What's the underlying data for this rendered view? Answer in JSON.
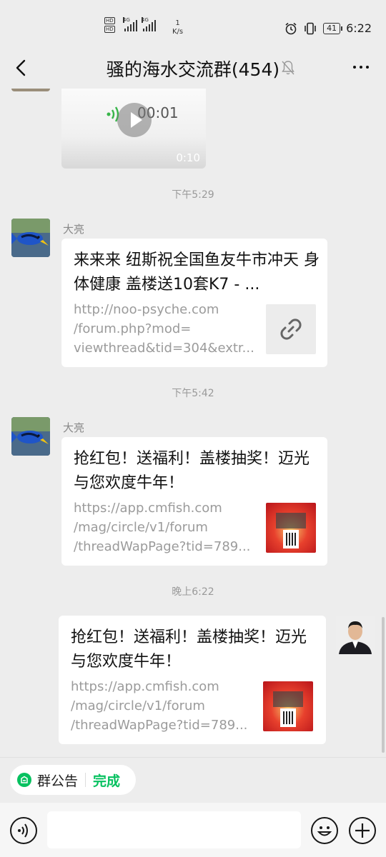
{
  "status_bar": {
    "hd1": "HD",
    "hd2": "HD",
    "net1": "4G",
    "net2": "4G",
    "speed_value": "1",
    "speed_unit": "K/s",
    "battery": "41",
    "time": "6:22"
  },
  "header": {
    "title": "骚的海水交流群(454)"
  },
  "messages": {
    "video": {
      "recording_time": "00:01",
      "duration": "0:10"
    },
    "time1": "下午5:29",
    "msg1": {
      "sender": "大亮",
      "title": "来来来 纽斯祝全国鱼友牛市冲天 身体健康 盖楼送10套K7 - ...",
      "url_lines": [
        "http://noo-psyche.com",
        "/forum.php?mod=",
        "viewthread&tid=304&extr..."
      ]
    },
    "time2": "下午5:42",
    "msg2": {
      "sender": "大亮",
      "title": "抢红包！送福利！盖楼抽奖！迈光与您欢度牛年！",
      "url_lines": [
        "https://app.cmfish.com",
        "/mag/circle/v1/forum",
        "/threadWapPage?tid=789..."
      ]
    },
    "time3": "晚上6:22",
    "msg3": {
      "title": "抢红包！送福利！盖楼抽奖！迈光与您欢度牛年！",
      "url_lines": [
        "https://app.cmfish.com",
        "/mag/circle/v1/forum",
        "/threadWapPage?tid=789..."
      ]
    }
  },
  "notice_bar": {
    "label": "群公告",
    "done": "完成"
  },
  "colors": {
    "accent": "#07c160",
    "background": "#ededed",
    "card": "#ffffff"
  }
}
